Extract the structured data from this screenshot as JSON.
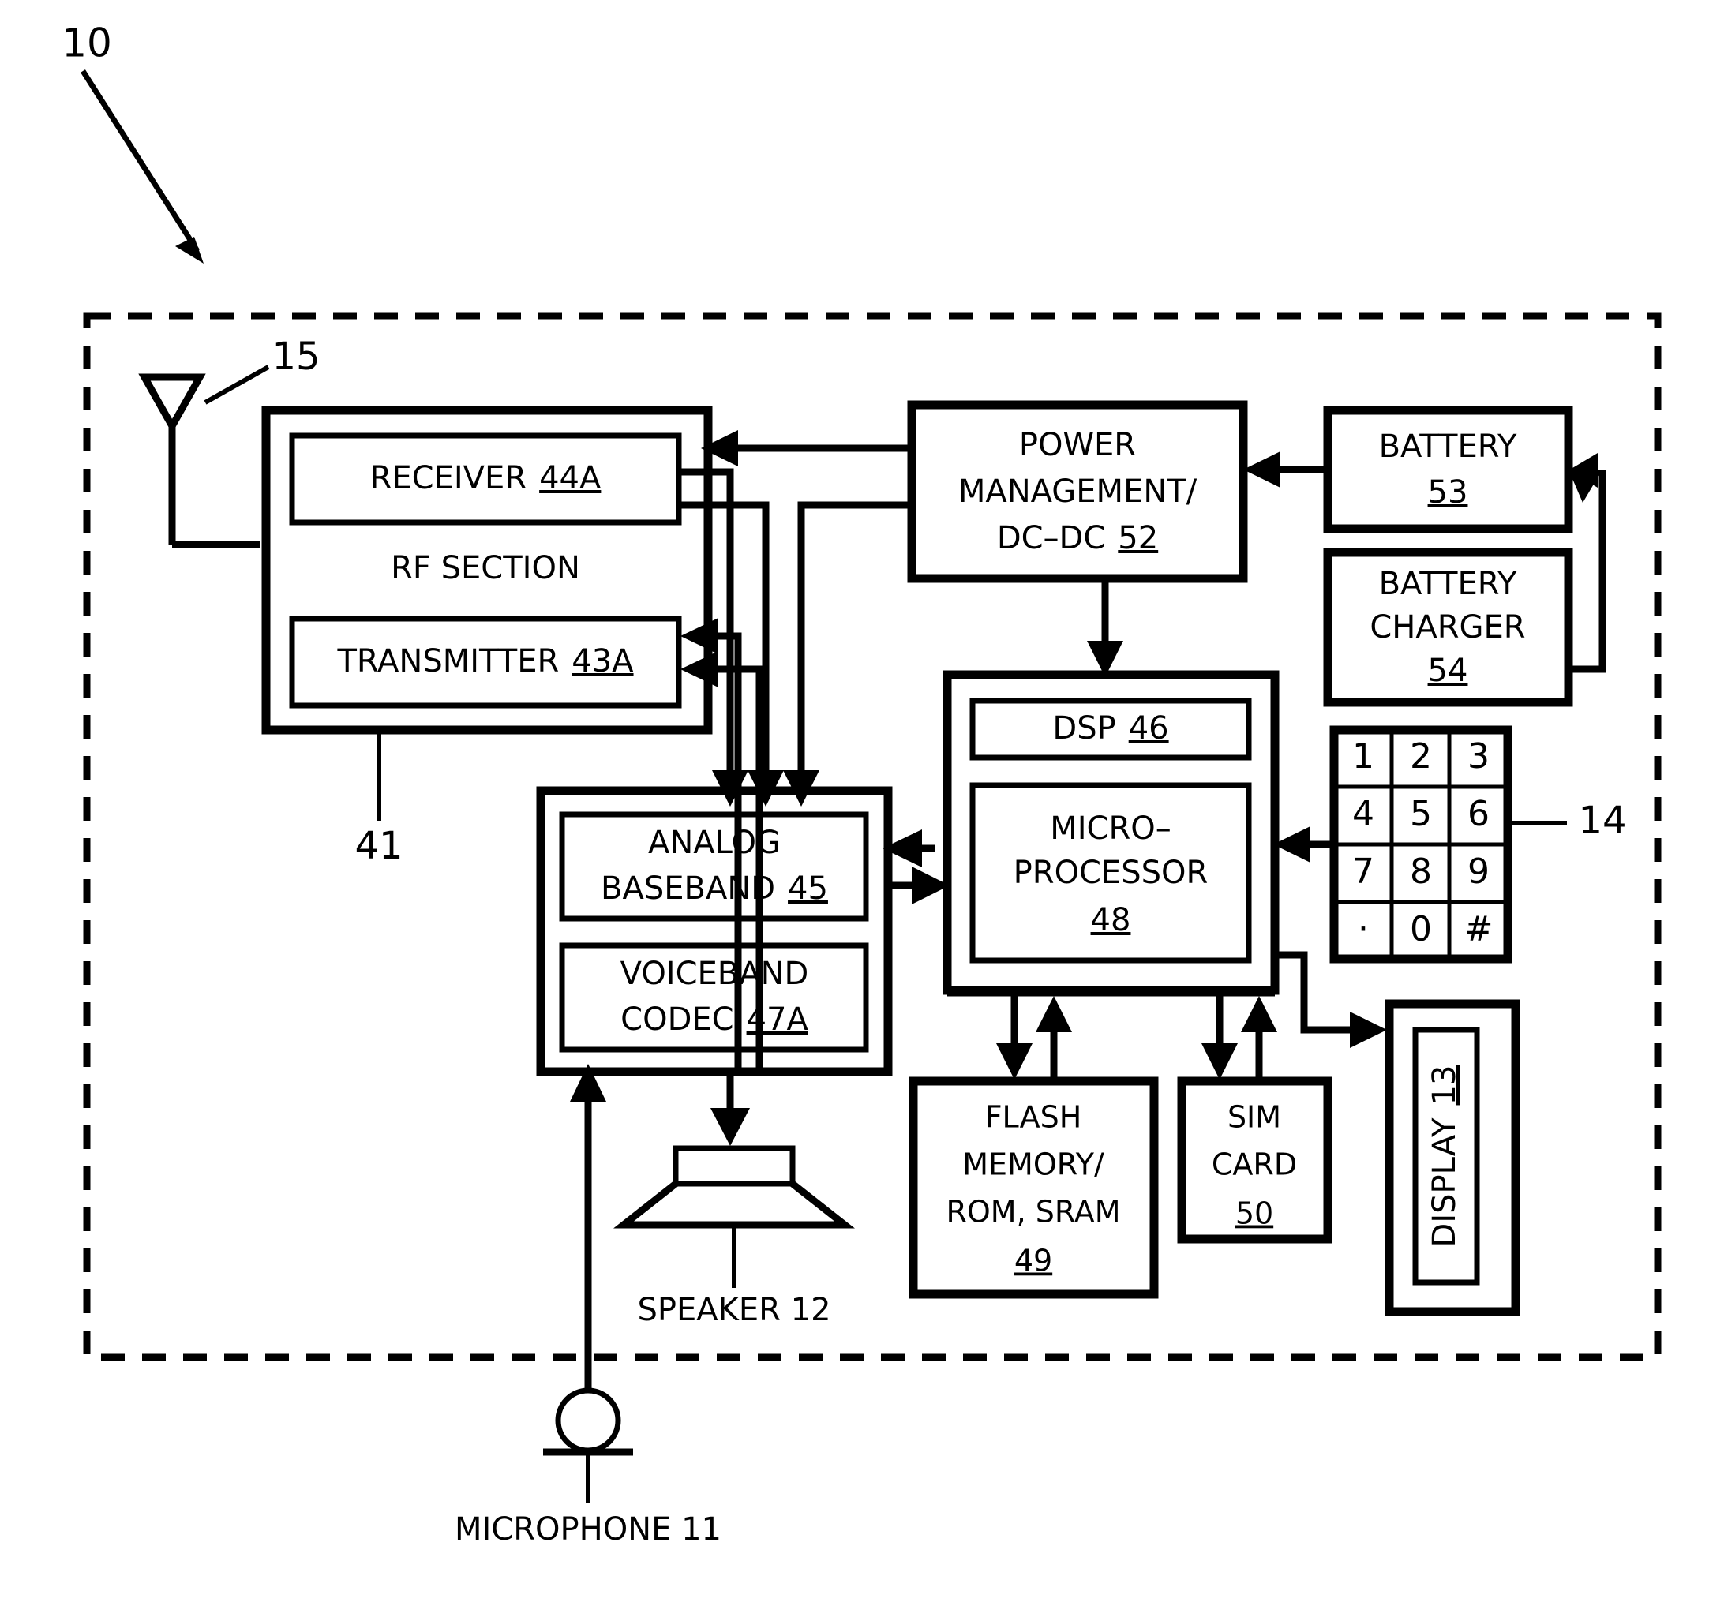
{
  "figure": {
    "reference_numerals": {
      "device": "10",
      "antenna": "15",
      "rf_section": "41",
      "keypad": "14"
    }
  },
  "blocks": {
    "rf_section": {
      "title": "RF SECTION",
      "receiver": {
        "name": "RECEIVER",
        "ref": "44A"
      },
      "transmitter": {
        "name": "TRANSMITTER",
        "ref": "43A"
      }
    },
    "power_management": {
      "line1": "POWER",
      "line2": "MANAGEMENT/",
      "line3": "DC–DC",
      "ref": "52"
    },
    "battery": {
      "name": "BATTERY",
      "ref": "53"
    },
    "battery_charger": {
      "line1": "BATTERY",
      "line2": "CHARGER",
      "ref": "54"
    },
    "processor_group": {
      "dsp": {
        "name": "DSP",
        "ref": "46"
      },
      "microprocessor": {
        "line1": "MICRO–",
        "line2": "PROCESSOR",
        "ref": "48"
      }
    },
    "baseband_group": {
      "analog_baseband": {
        "line1": "ANALOG",
        "line2": "BASEBAND",
        "ref": "45"
      },
      "voiceband_codec": {
        "line1": "VOICEBAND",
        "line2": "CODEC",
        "ref": "47A"
      }
    },
    "flash_memory": {
      "line1": "FLASH",
      "line2": "MEMORY/",
      "line3": "ROM, SRAM",
      "ref": "49"
    },
    "sim_card": {
      "line1": "SIM",
      "line2": "CARD",
      "ref": "50"
    },
    "display": {
      "name": "DISPLAY",
      "ref": "13"
    },
    "speaker": {
      "label": "SPEAKER 12"
    },
    "microphone": {
      "label": "MICROPHONE 11"
    }
  },
  "keypad": {
    "ref": "14",
    "rows": [
      [
        "1",
        "2",
        "3"
      ],
      [
        "4",
        "5",
        "6"
      ],
      [
        "7",
        "8",
        "9"
      ],
      [
        "·",
        "0",
        "#"
      ]
    ]
  },
  "colors": {
    "ink": "#000000",
    "paper": "#ffffff"
  }
}
